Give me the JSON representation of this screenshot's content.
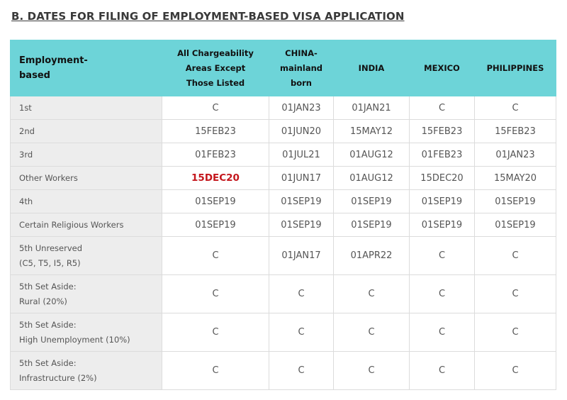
{
  "title": "B. DATES FOR FILING OF EMPLOYMENT-BASED VISA APPLICATION",
  "headers": {
    "category": [
      "Employment-",
      "based"
    ],
    "all_chargeability": [
      "All Chargeability",
      "Areas Except",
      "Those Listed"
    ],
    "china": [
      "CHINA-",
      "mainland",
      "born"
    ],
    "india": "INDIA",
    "mexico": "MEXICO",
    "philippines": "PHILIPPINES"
  },
  "colors": {
    "header_bg": "#6dd4d8",
    "label_bg": "#ededed",
    "highlight_text": "#c4161c"
  },
  "rows": [
    {
      "label": [
        "1st"
      ],
      "values": [
        "C",
        "01JAN23",
        "01JAN21",
        "C",
        "C"
      ]
    },
    {
      "label": [
        "2nd"
      ],
      "values": [
        "15FEB23",
        "01JUN20",
        "15MAY12",
        "15FEB23",
        "15FEB23"
      ]
    },
    {
      "label": [
        "3rd"
      ],
      "values": [
        "01FEB23",
        "01JUL21",
        "01AUG12",
        "01FEB23",
        "01JAN23"
      ]
    },
    {
      "label": [
        "Other Workers"
      ],
      "values": [
        "15DEC20",
        "01JUN17",
        "01AUG12",
        "15DEC20",
        "15MAY20"
      ]
    },
    {
      "label": [
        "4th"
      ],
      "values": [
        "01SEP19",
        "01SEP19",
        "01SEP19",
        "01SEP19",
        "01SEP19"
      ]
    },
    {
      "label": [
        "Certain Religious Workers"
      ],
      "values": [
        "01SEP19",
        "01SEP19",
        "01SEP19",
        "01SEP19",
        "01SEP19"
      ]
    },
    {
      "label": [
        "5th Unreserved",
        "(C5, T5, I5, R5)"
      ],
      "values": [
        "C",
        "01JAN17",
        "01APR22",
        "C",
        "C"
      ]
    },
    {
      "label": [
        "5th Set Aside:",
        "Rural (20%)"
      ],
      "values": [
        "C",
        "C",
        "C",
        "C",
        "C"
      ]
    },
    {
      "label": [
        "5th Set Aside:",
        "High Unemployment (10%)"
      ],
      "values": [
        "C",
        "C",
        "C",
        "C",
        "C"
      ]
    },
    {
      "label": [
        "5th Set Aside:",
        "Infrastructure (2%)"
      ],
      "values": [
        "C",
        "C",
        "C",
        "C",
        "C"
      ]
    }
  ]
}
